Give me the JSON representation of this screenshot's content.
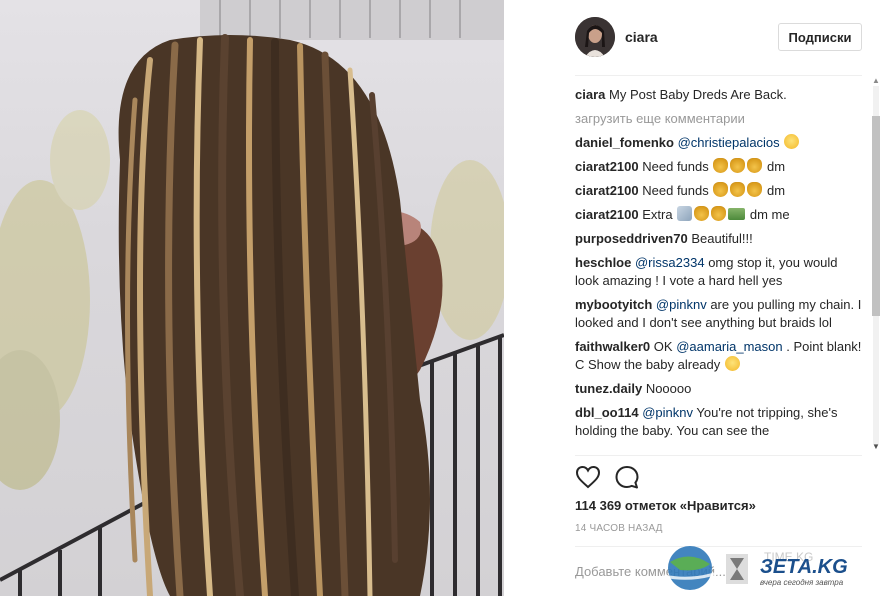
{
  "post": {
    "username": "ciara",
    "follow_label": "Подписки",
    "caption": {
      "author": "ciara",
      "text": "My Post Baby Dreds Are Back."
    },
    "load_more": "загрузить еще комментарии",
    "comments": [
      {
        "author": "daniel_fomenko",
        "mention": "@christiepalacios",
        "text": "",
        "emoji": [
          "face"
        ]
      },
      {
        "author": "ciarat2100",
        "mention": "",
        "text": "Need funds",
        "emoji": [
          "bag",
          "bag",
          "bag"
        ],
        "text_after": "dm"
      },
      {
        "author": "ciarat2100",
        "mention": "",
        "text": "Need funds",
        "emoji": [
          "bag",
          "bag",
          "bag"
        ],
        "text_after": "dm"
      },
      {
        "author": "ciarat2100",
        "mention": "",
        "text": "Extra",
        "emoji": [
          "sparkle",
          "bag",
          "bag",
          "bill"
        ],
        "text_after": "dm me"
      },
      {
        "author": "purposeddriven70",
        "mention": "",
        "text": "Beautiful!!!",
        "emoji": []
      },
      {
        "author": "heschloe",
        "mention": "@rissa2334",
        "text": "omg stop it, you would look amazing ! I vote a hard hell yes",
        "emoji": []
      },
      {
        "author": "mybootyitch",
        "mention": "@pinknv",
        "text": "are you pulling my chain. I looked and I don't see anything but braids lol",
        "emoji": []
      },
      {
        "author": "faithwalker0",
        "mention_prefix": "OK",
        "mention": "@aamaria_mason",
        "text": ". Point blank! C Show the baby already",
        "emoji": [
          "face"
        ]
      },
      {
        "author": "tunez.daily",
        "mention": "",
        "text": "Nooooo",
        "emoji": []
      },
      {
        "author": "dbl_oo114",
        "mention": "@pinknv",
        "text": "You're not tripping, she's holding the baby. You can see the",
        "emoji": []
      }
    ],
    "likes": "114 369 отметок «Нравится»",
    "timestamp": "14 ЧАСОВ НАЗАД",
    "add_comment_placeholder": "Добавьте комментарий..."
  },
  "watermark": {
    "brand": "ЗЕТА.KG",
    "tagline": "вчера сегодня завтра",
    "faded": "TIME.KG"
  },
  "colors": {
    "link": "#003569",
    "muted": "#999999",
    "divider": "#efefef"
  }
}
